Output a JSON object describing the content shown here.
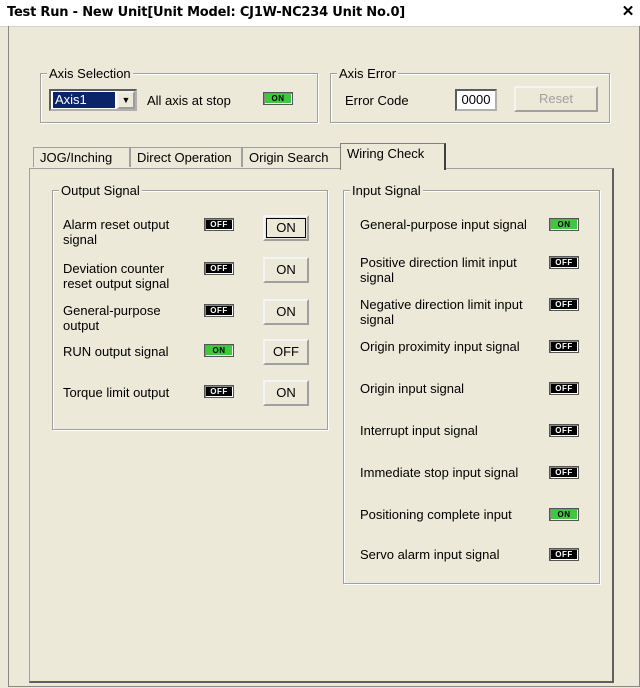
{
  "window": {
    "title": "Test Run - New Unit[Unit Model: CJ1W-NC234 Unit No.0]",
    "close_glyph": "✕"
  },
  "axis_selection": {
    "legend": "Axis Selection",
    "selected": "Axis1",
    "all_stop_label": "All axis at stop",
    "all_stop_state": "ON"
  },
  "axis_error": {
    "legend": "Axis Error",
    "error_code_label": "Error Code",
    "error_code": "0000",
    "reset_label": "Reset"
  },
  "tabs": [
    {
      "label": "JOG/Inching"
    },
    {
      "label": "Direct Operation"
    },
    {
      "label": "Origin Search"
    },
    {
      "label": "Wiring Check"
    }
  ],
  "output_signal": {
    "legend": "Output Signal",
    "rows": [
      {
        "label": "Alarm reset output signal",
        "state": "OFF",
        "button": "ON"
      },
      {
        "label": "Deviation counter reset output signal",
        "state": "OFF",
        "button": "ON"
      },
      {
        "label": "General-purpose output",
        "state": "OFF",
        "button": "ON"
      },
      {
        "label": "RUN output signal",
        "state": "ON",
        "button": "OFF"
      },
      {
        "label": "Torque limit output",
        "state": "OFF",
        "button": "ON"
      }
    ]
  },
  "input_signal": {
    "legend": "Input Signal",
    "rows": [
      {
        "label": "General-purpose input signal",
        "state": "ON"
      },
      {
        "label": "Positive direction limit input signal",
        "state": "OFF"
      },
      {
        "label": "Negative direction limit input signal",
        "state": "OFF"
      },
      {
        "label": "Origin proximity input signal",
        "state": "OFF"
      },
      {
        "label": "Origin input signal",
        "state": "OFF"
      },
      {
        "label": "Interrupt input signal",
        "state": "OFF"
      },
      {
        "label": "Immediate stop input signal",
        "state": "OFF"
      },
      {
        "label": "Positioning complete input",
        "state": "ON"
      },
      {
        "label": "Servo alarm input signal",
        "state": "OFF"
      }
    ]
  },
  "colors": {
    "lamp_on": "#3ec83e",
    "lamp_off": "#000000",
    "dialog_bg": "#ece9d8",
    "combo_selection": "#0a246a"
  }
}
